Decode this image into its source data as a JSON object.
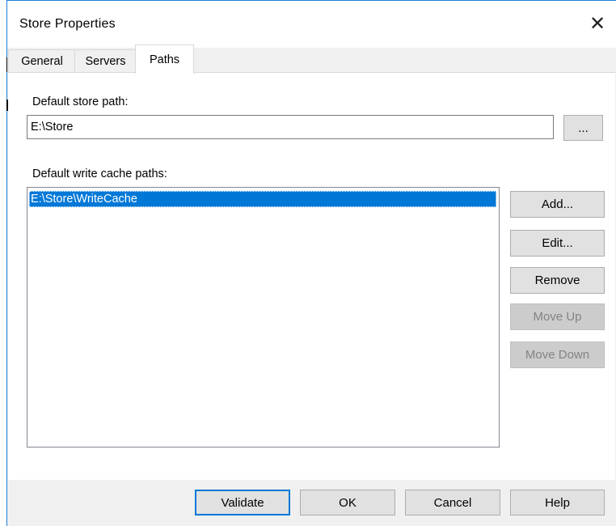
{
  "window": {
    "title": "Store Properties",
    "close_glyph": "✕"
  },
  "tabs": [
    {
      "label": "General",
      "active": false
    },
    {
      "label": "Servers",
      "active": false
    },
    {
      "label": "Paths",
      "active": true
    }
  ],
  "paths": {
    "store_path_label": "Default store path:",
    "store_path_value": "E:\\Store",
    "browse_label": "...",
    "write_cache_label": "Default write cache paths:",
    "write_cache_items": [
      "E:\\Store\\WriteCache"
    ],
    "buttons": {
      "add": "Add...",
      "edit": "Edit...",
      "remove": "Remove",
      "move_up": "Move Up",
      "move_down": "Move Down"
    }
  },
  "footer": {
    "validate": "Validate",
    "ok": "OK",
    "cancel": "Cancel",
    "help": "Help"
  },
  "colors": {
    "accent": "#0078d7",
    "window_border": "#1e7fd8"
  }
}
